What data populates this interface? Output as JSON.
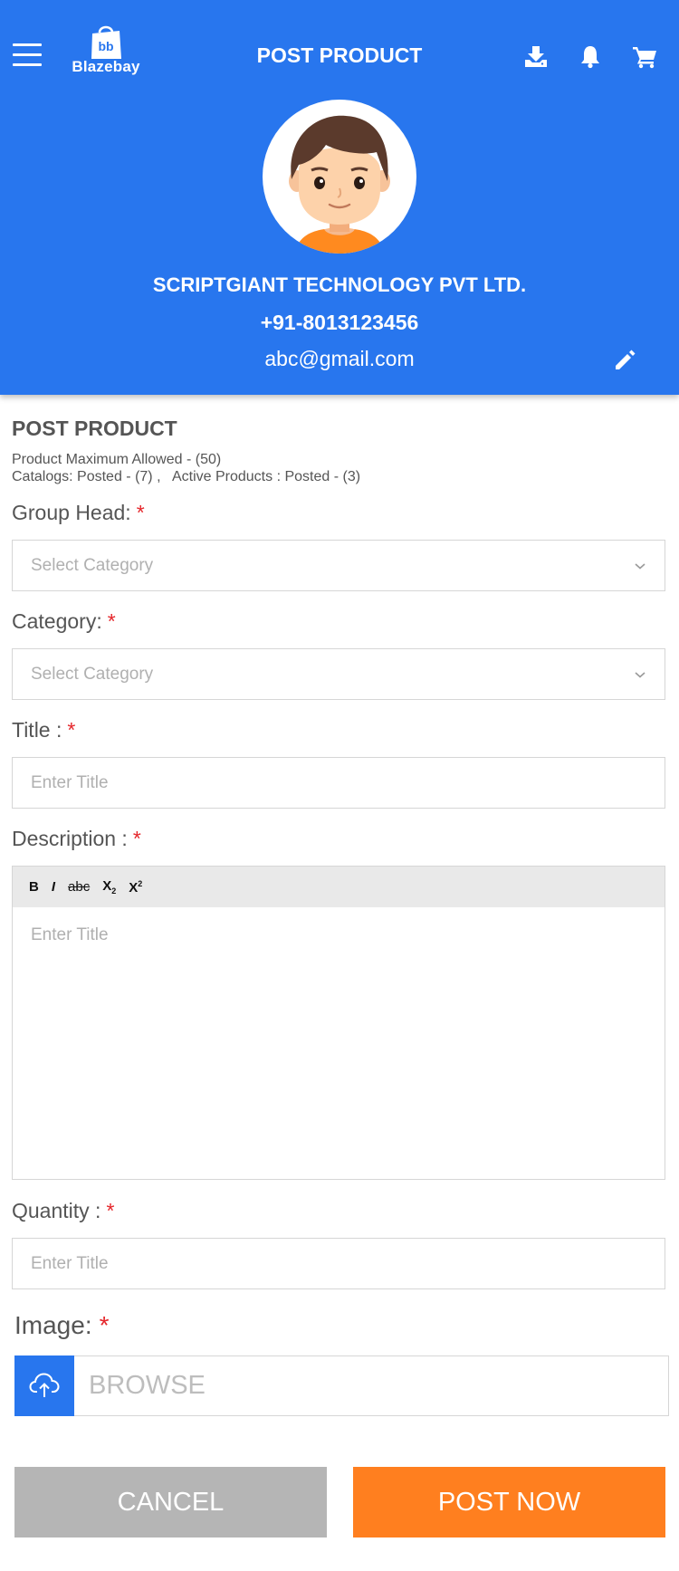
{
  "header": {
    "title": "POST PRODUCT",
    "logo_text": "Blazebay",
    "logo_monogram": "bb",
    "icons": [
      "menu-icon",
      "download-icon",
      "bell-icon",
      "cart-icon"
    ]
  },
  "profile": {
    "company": "SCRIPTGIANT TECHNOLOGY PVT LTD.",
    "phone": "+91-8013123456",
    "email": "abc@gmail.com"
  },
  "form": {
    "section_title": "POST PRODUCT",
    "info_line1": "Product Maximum Allowed - (50)",
    "info_line2": "Catalogs: Posted - (7) ,   Active Products : Posted - (3)",
    "required_mark": "*",
    "group_head": {
      "label": "Group Head:",
      "placeholder": "Select Category"
    },
    "category": {
      "label": "Category:",
      "placeholder": "Select Category"
    },
    "title": {
      "label": "Title :",
      "placeholder": "Enter Title"
    },
    "description": {
      "label": "Description :",
      "placeholder": "Enter Title",
      "toolbar": {
        "bold": "B",
        "italic": "I",
        "strike": "abc",
        "sub_base": "X",
        "sub": "2",
        "sup_base": "X",
        "sup": "2"
      }
    },
    "quantity": {
      "label": "Quantity :",
      "placeholder": "Enter Title"
    },
    "image": {
      "label": "Image:",
      "browse": "BROWSE"
    }
  },
  "actions": {
    "cancel": "CANCEL",
    "post": "POST NOW"
  },
  "colors": {
    "primary": "#2876ee",
    "accent": "#ff7f1f",
    "cancel": "#b5b5b5",
    "required": "#e5262b"
  }
}
